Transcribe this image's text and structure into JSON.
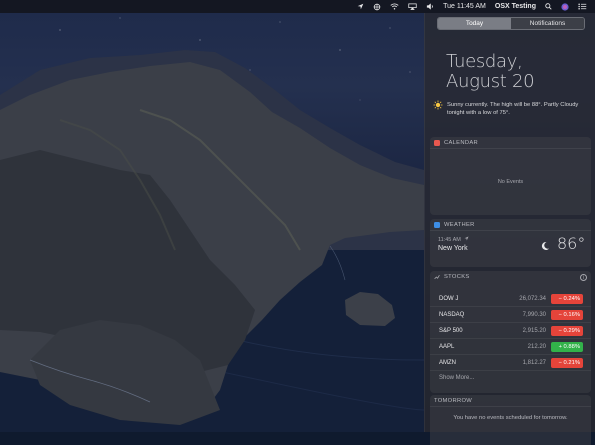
{
  "menubar": {
    "clock": "Tue 11:45 AM",
    "user": "OSX Testing",
    "icons": [
      "location-icon",
      "vpn-icon",
      "wifi-icon",
      "airplay-icon",
      "volume-icon",
      "search-icon",
      "siri-icon",
      "notification-center-icon"
    ]
  },
  "panel": {
    "tabs": [
      {
        "label": "Today",
        "active": true
      },
      {
        "label": "Notifications",
        "active": false
      }
    ],
    "date": {
      "weekday": "Tuesday,",
      "month_day": "August 20"
    },
    "summary": "Sunny currently. The high will be 88°. Partly Cloudy tonight with a low of 75°.",
    "calendar": {
      "title": "CALENDAR",
      "empty_text": "No Events"
    },
    "weather": {
      "title": "WEATHER",
      "time": "11:45 AM",
      "city": "New York",
      "temp": "86°"
    },
    "stocks": {
      "title": "STOCKS",
      "rows": [
        {
          "symbol": "DOW J",
          "price": "26,072.34",
          "change": "− 0.24%",
          "direction": "down"
        },
        {
          "symbol": "NASDAQ",
          "price": "7,990.30",
          "change": "− 0.16%",
          "direction": "down"
        },
        {
          "symbol": "S&P 500",
          "price": "2,915.20",
          "change": "− 0.29%",
          "direction": "down"
        },
        {
          "symbol": "AAPL",
          "price": "212.20",
          "change": "+ 0.88%",
          "direction": "up"
        },
        {
          "symbol": "AMZN",
          "price": "1,812.27",
          "change": "− 0.21%",
          "direction": "down"
        }
      ],
      "show_more": "Show More..."
    },
    "tomorrow": {
      "title": "TOMORROW",
      "text": "You have no events scheduled for tomorrow."
    }
  },
  "colors": {
    "down": "#e5443a",
    "up": "#32b24a",
    "calendar_icon": "#e8584f",
    "weather_icon": "#3d8ee6"
  }
}
